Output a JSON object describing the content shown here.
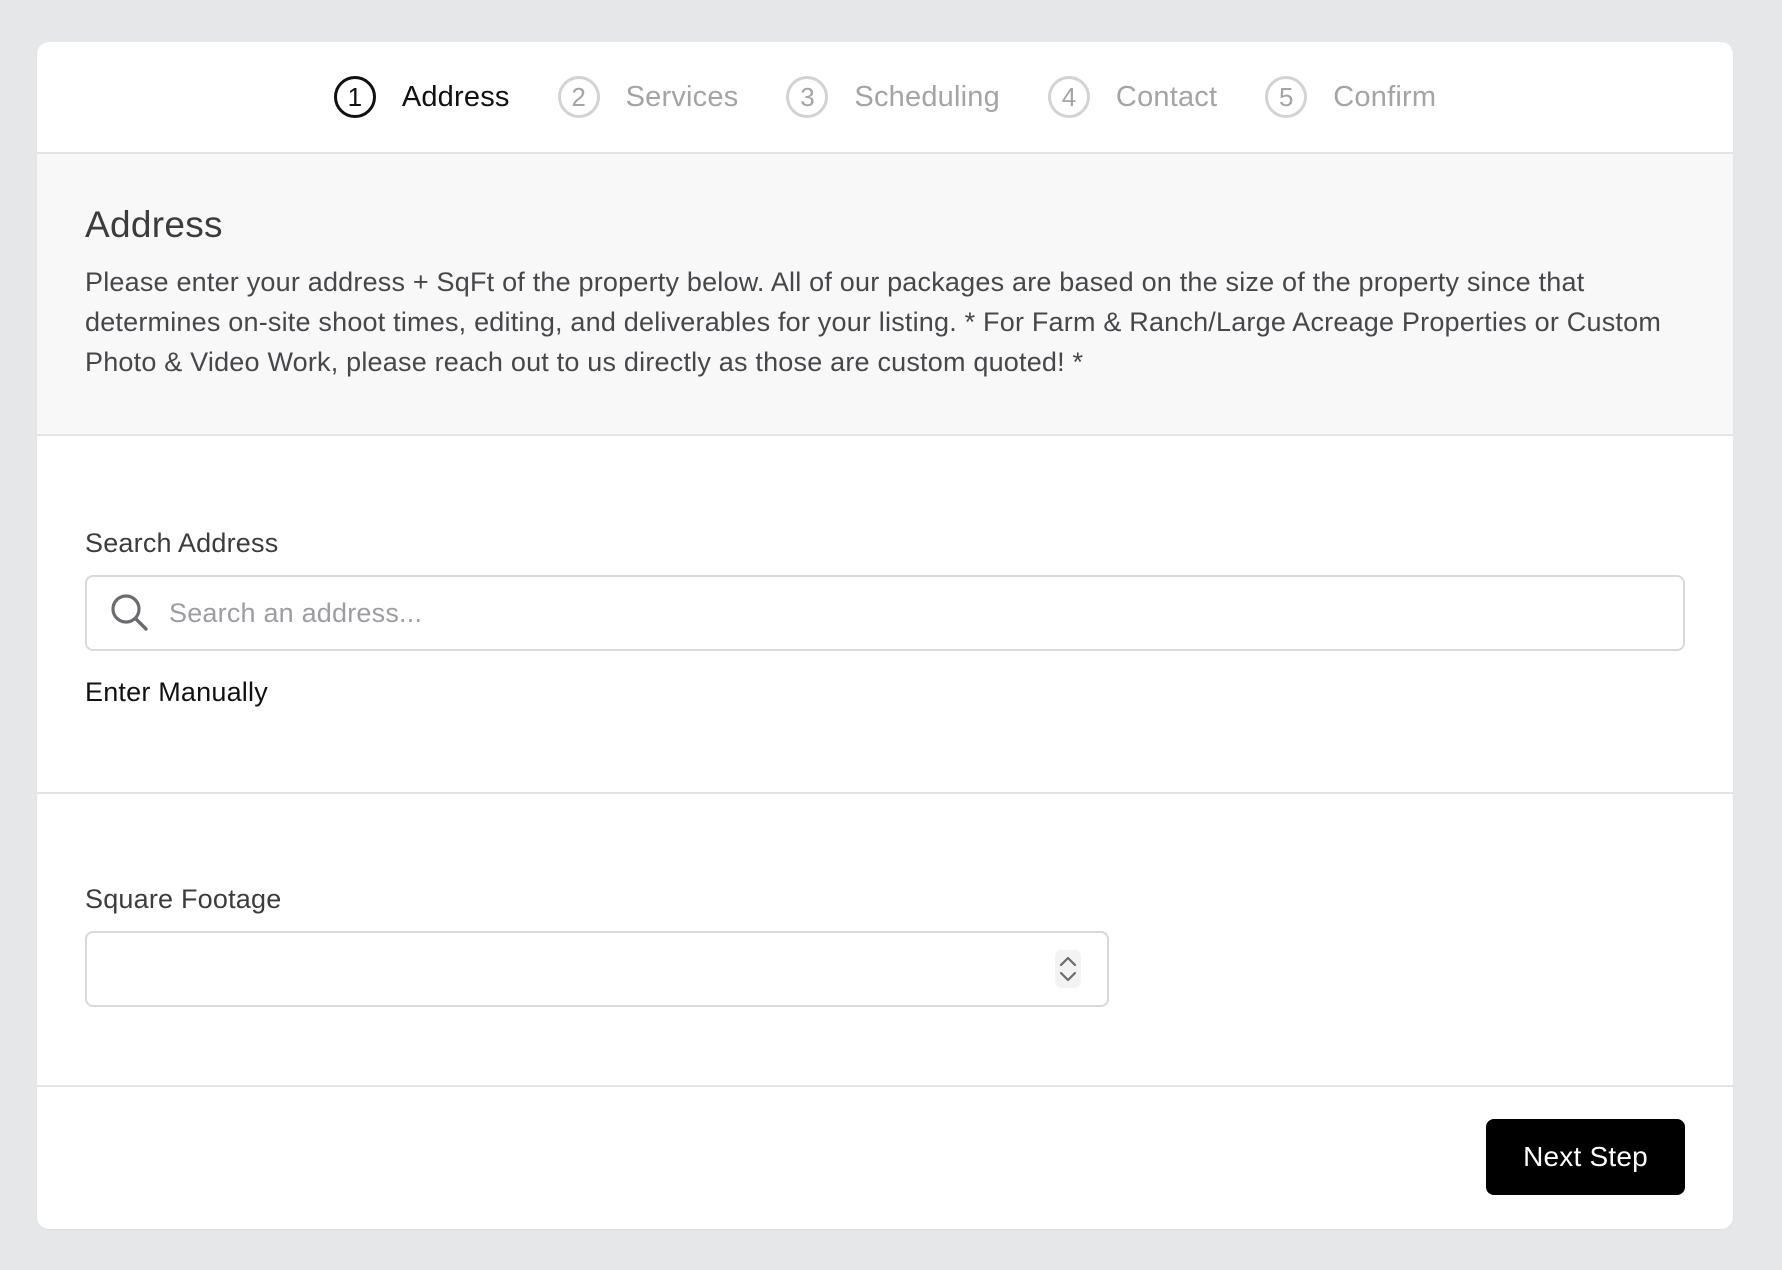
{
  "stepper": {
    "steps": [
      {
        "number": "1",
        "label": "Address",
        "active": true
      },
      {
        "number": "2",
        "label": "Services",
        "active": false
      },
      {
        "number": "3",
        "label": "Scheduling",
        "active": false
      },
      {
        "number": "4",
        "label": "Contact",
        "active": false
      },
      {
        "number": "5",
        "label": "Confirm",
        "active": false
      }
    ]
  },
  "intro": {
    "title": "Address",
    "description": "Please enter your address + SqFt of the property below. All of our packages are based on the size of the property since that determines on-site shoot times, editing, and deliverables for your listing. * For Farm & Ranch/Large Acreage Properties or Custom Photo & Video Work, please reach out to us directly as those are custom quoted! *"
  },
  "address": {
    "label": "Search Address",
    "placeholder": "Search an address...",
    "value": "",
    "manual_link": "Enter Manually",
    "icon": "search-icon"
  },
  "sqft": {
    "label": "Square Footage",
    "value": "",
    "icon": "stepper-arrows-icon"
  },
  "footer": {
    "next_label": "Next Step"
  },
  "colors": {
    "background": "#e6e7e9",
    "card": "#ffffff",
    "intro_background": "#f8f8f8",
    "active": "#111111",
    "inactive": "#a3a4a6",
    "button": "#000000"
  }
}
